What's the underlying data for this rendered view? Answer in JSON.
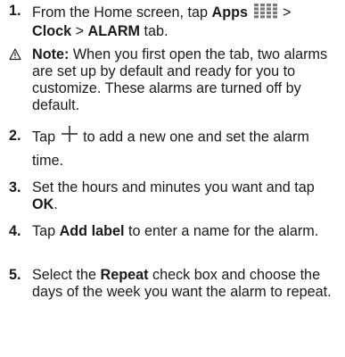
{
  "steps": [
    {
      "number": "1.",
      "parts": [
        {
          "t": "From the Home screen, tap "
        },
        {
          "t": "Apps",
          "b": true
        },
        {
          "icon": "apps-grid-icon"
        },
        {
          "t": " > "
        },
        {
          "t": "Clock",
          "b": true
        },
        {
          "t": " > "
        },
        {
          "t": "ALARM",
          "b": true
        },
        {
          "t": " tab."
        }
      ]
    },
    {
      "note_label": "Note:",
      "note_text": " When you first open the tab, two alarms are set up by default and ready for you to customize. These alarms are turned off by default."
    },
    {
      "number": "2.",
      "parts": [
        {
          "t": "Tap "
        },
        {
          "icon": "plus-icon"
        },
        {
          "t": " to add a new one and set the alarm time."
        }
      ]
    },
    {
      "number": "3.",
      "parts": [
        {
          "t": "Set the hours and minutes you want and tap "
        },
        {
          "t": "OK",
          "b": true
        },
        {
          "t": "."
        }
      ]
    },
    {
      "number": "4.",
      "parts": [
        {
          "t": "Tap "
        },
        {
          "t": "Add label",
          "b": true
        },
        {
          "t": " to enter a name for the alarm."
        }
      ]
    },
    {
      "number": "5.",
      "parts": [
        {
          "t": "Select the "
        },
        {
          "t": "Repeat",
          "b": true
        },
        {
          "t": " check box and choose the days of the week you want the alarm to repeat."
        }
      ]
    }
  ]
}
